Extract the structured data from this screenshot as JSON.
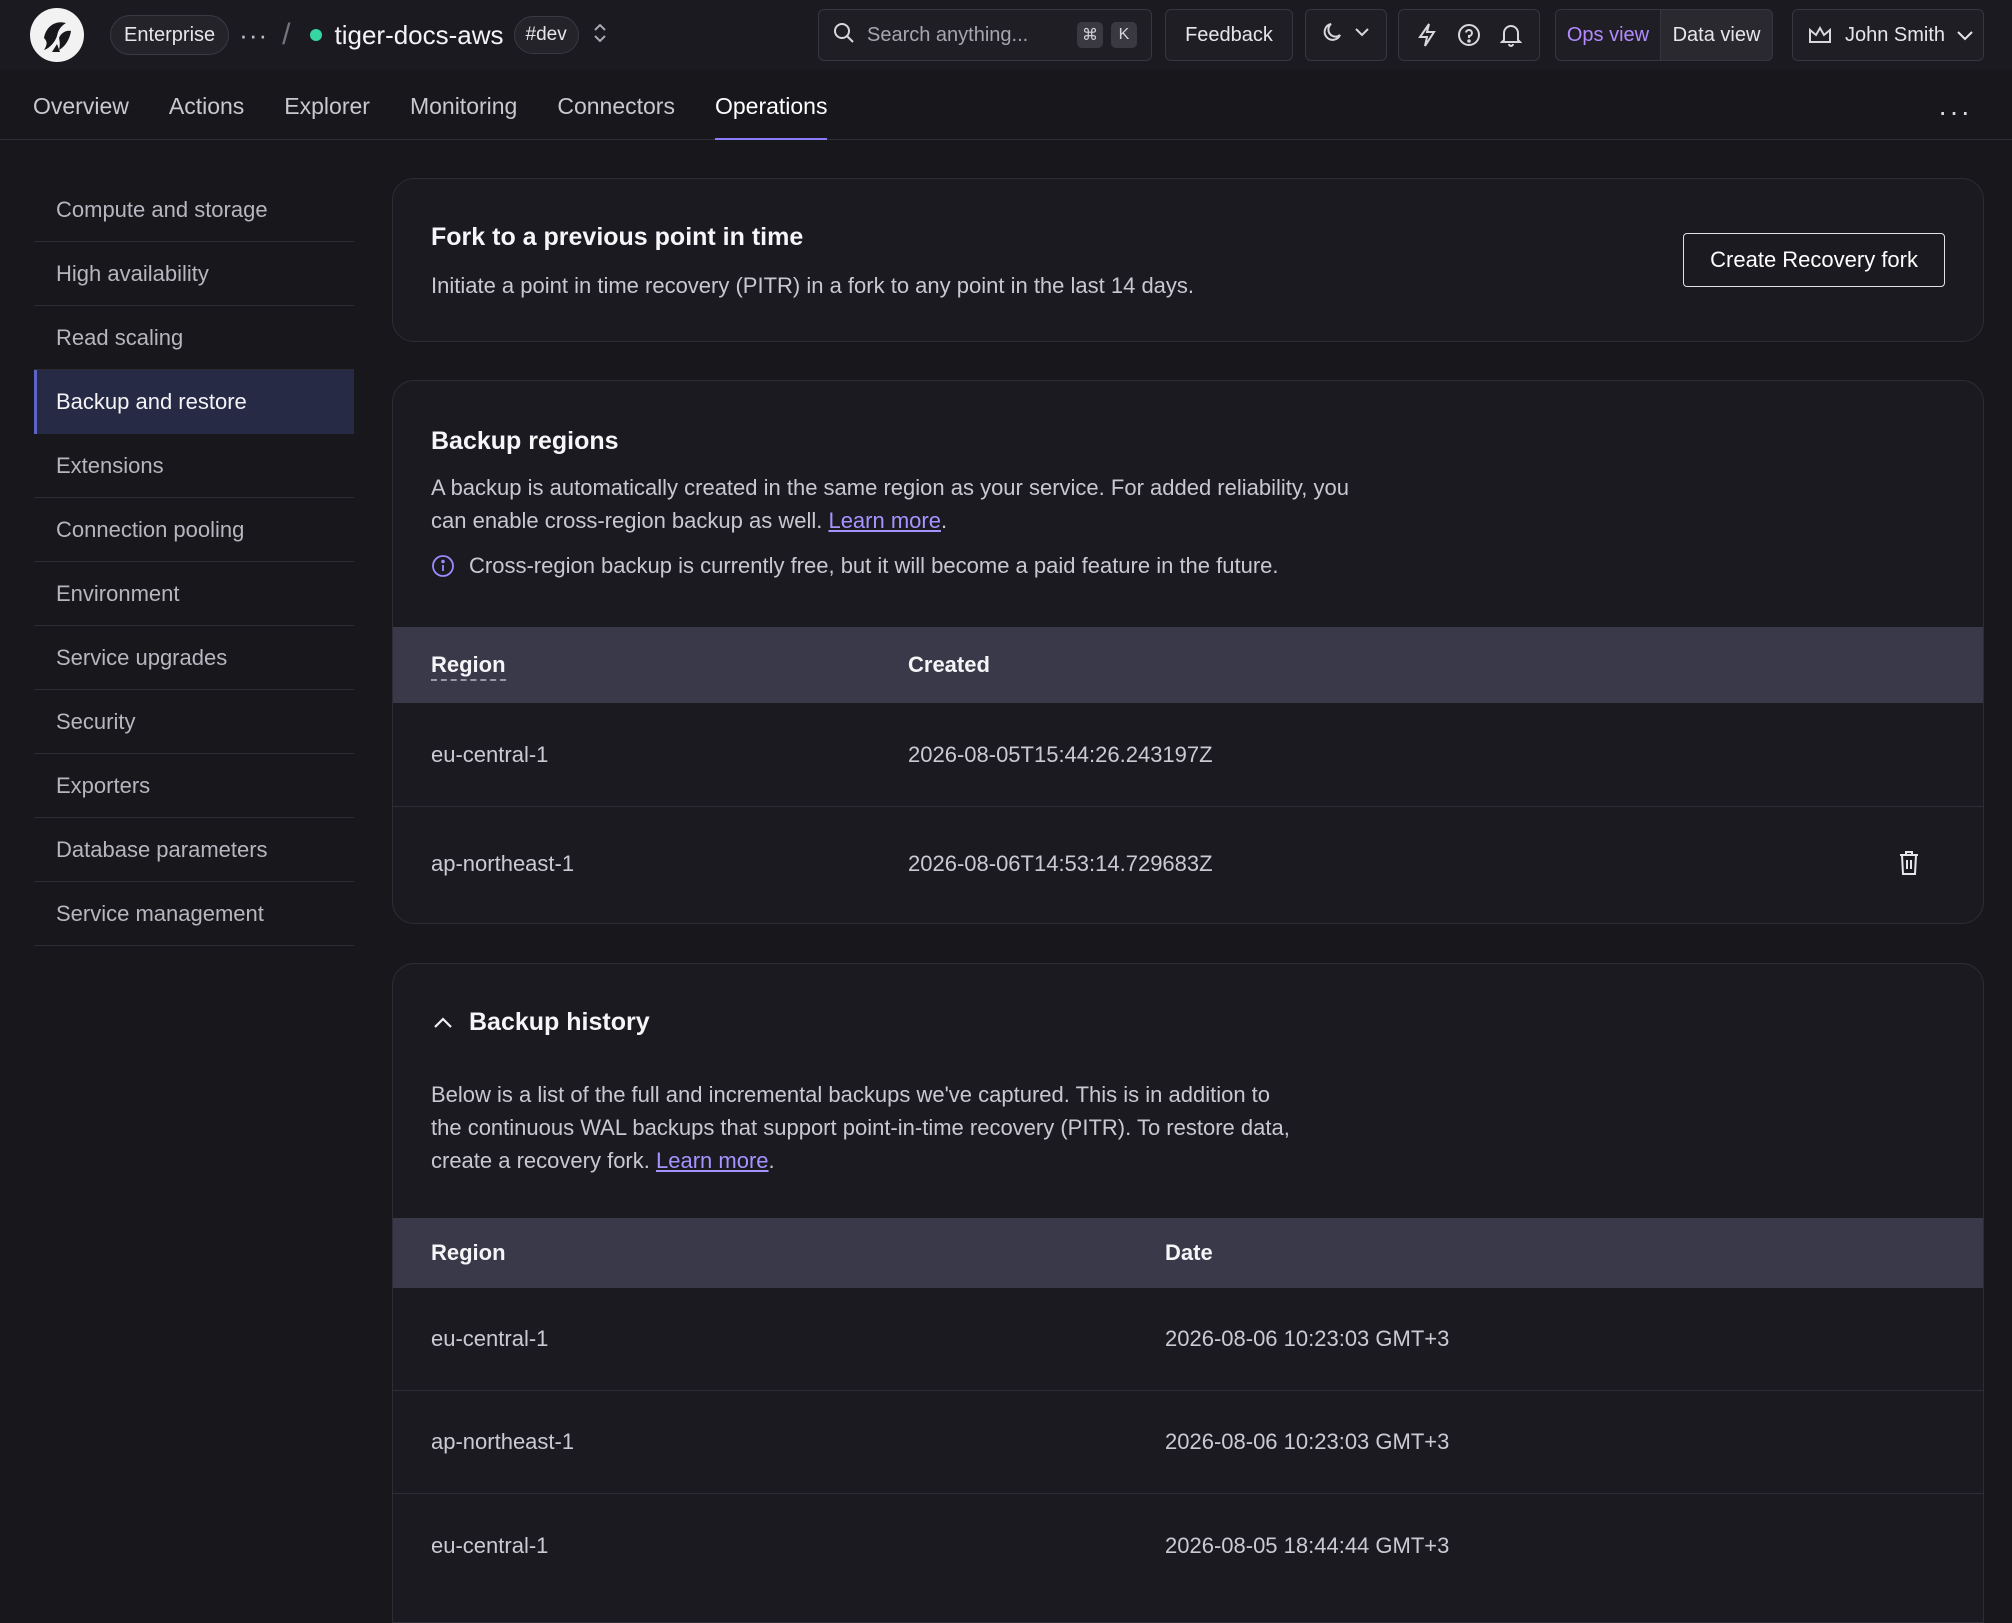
{
  "topbar": {
    "plan": "Enterprise",
    "service_name": "tiger-docs-aws",
    "env_tag": "#dev",
    "search_placeholder": "Search anything...",
    "shortcut_mod": "⌘",
    "shortcut_key": "K",
    "feedback": "Feedback",
    "ops_view": "Ops view",
    "data_view": "Data view",
    "user_name": "John Smith"
  },
  "tabs": [
    "Overview",
    "Actions",
    "Explorer",
    "Monitoring",
    "Connectors",
    "Operations"
  ],
  "active_tab": "Operations",
  "sidebar": {
    "items": [
      "Compute and storage",
      "High availability",
      "Read scaling",
      "Backup and restore",
      "Extensions",
      "Connection pooling",
      "Environment",
      "Service upgrades",
      "Security",
      "Exporters",
      "Database parameters",
      "Service management"
    ],
    "active": "Backup and restore"
  },
  "fork": {
    "title": "Fork to a previous point in time",
    "description": "Initiate a point in time recovery (PITR) in a fork to any point in the last 14 days.",
    "button": "Create Recovery fork"
  },
  "backup_regions": {
    "title": "Backup regions",
    "desc_line1": "A backup is automatically created in the same region as your service. For added reliability, you",
    "desc_line2_pre": "can enable cross-region backup as well.",
    "learn_more": "Learn more",
    "period": ".",
    "notice": "Cross-region backup is currently free, but it will become a paid feature in the future.",
    "headers": {
      "region": "Region",
      "created": "Created"
    },
    "rows": [
      {
        "region": "eu-central-1",
        "created": "2026-08-05T15:44:26.243197Z"
      },
      {
        "region": "ap-northeast-1",
        "created": "2026-08-06T14:53:14.729683Z"
      }
    ]
  },
  "backup_history": {
    "title": "Backup history",
    "desc_line1": "Below is a list of the full and incremental backups we've captured. This is in addition to",
    "desc_line2": "the continuous WAL backups that support point-in-time recovery (PITR). To restore data,",
    "desc_line3_pre": "create a recovery fork.",
    "learn_more": "Learn more",
    "period": ".",
    "headers": {
      "region": "Region",
      "date": "Date"
    },
    "rows": [
      {
        "region": "eu-central-1",
        "date": "2026-08-06 10:23:03 GMT+3"
      },
      {
        "region": "ap-northeast-1",
        "date": "2026-08-06 10:23:03 GMT+3"
      },
      {
        "region": "eu-central-1",
        "date": "2026-08-05 18:44:44 GMT+3"
      }
    ]
  },
  "colors": {
    "background": "#18171c",
    "accent": "#8b7dfa",
    "status_ok": "#35d6a2",
    "table_header": "#3a394a",
    "link": "#a594ff"
  },
  "icons": [
    "logo",
    "more-horizontal-icon",
    "chevron-up-down-icon",
    "search-icon",
    "moon-icon",
    "chevron-down-icon",
    "lightning-icon",
    "help-icon",
    "bell-icon",
    "crown-icon",
    "info-icon",
    "trash-icon",
    "chevron-up-icon"
  ]
}
